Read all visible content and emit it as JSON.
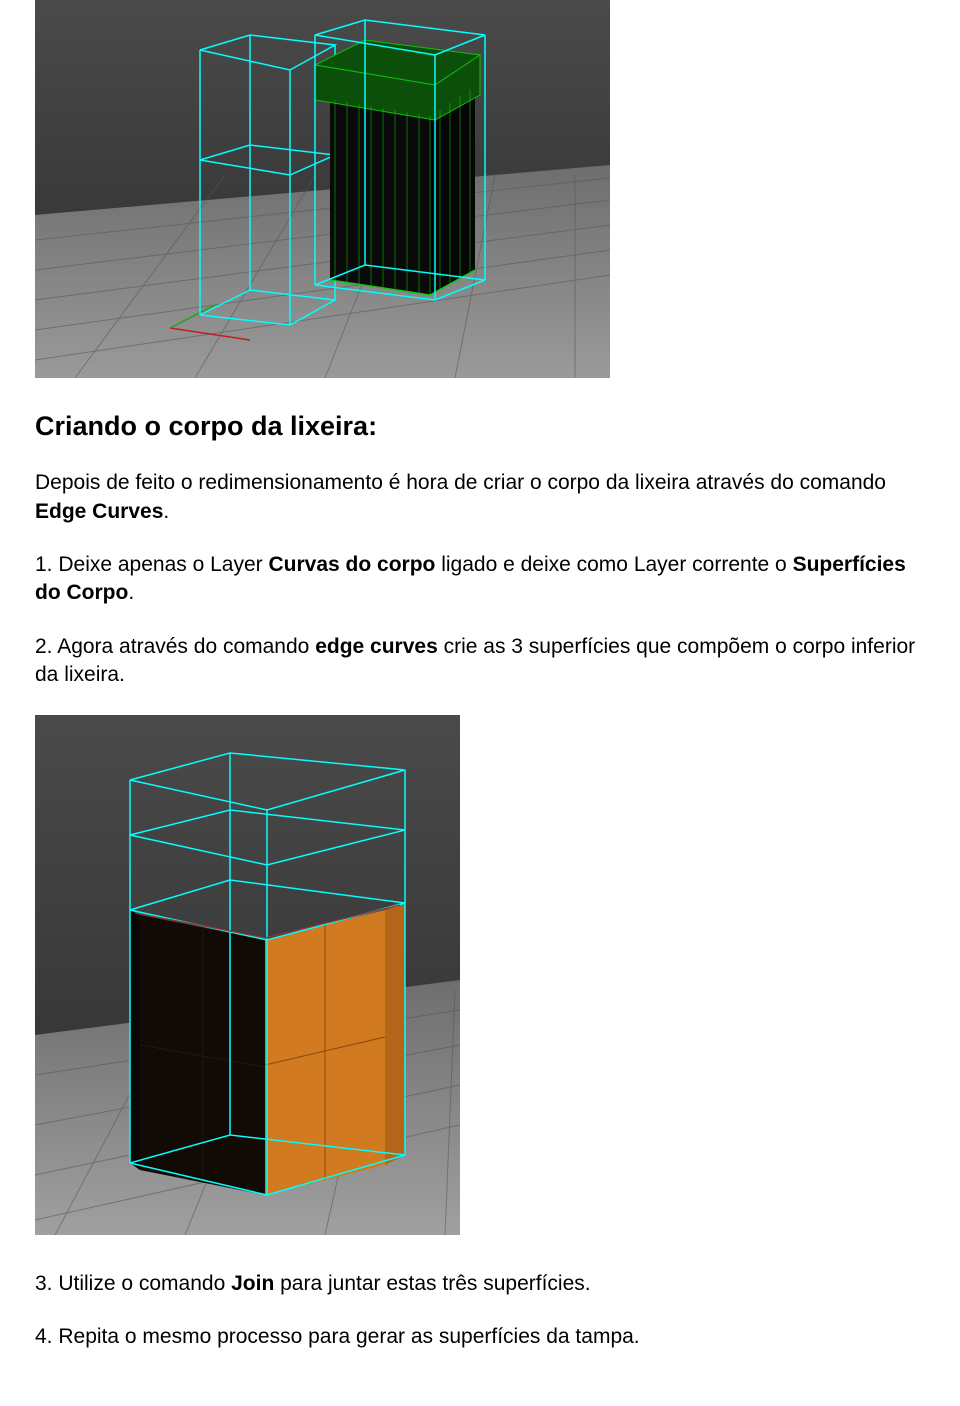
{
  "heading": "Criando o corpo da lixeira:",
  "intro": {
    "t1": "Depois de feito o redimensionamento é hora de criar o corpo da lixeira através do comando ",
    "b1": "Edge Curves",
    "t2": "."
  },
  "step1": {
    "t1": "1. Deixe apenas o Layer ",
    "b1": "Curvas do corpo",
    "t2": " ligado e deixe como Layer corrente o ",
    "b2": "Superfícies do Corpo",
    "t3": "."
  },
  "step2": {
    "t1": "2. Agora através do comando ",
    "b1": "edge curves",
    "t2": " crie as 3 superfícies que compõem o corpo inferior da lixeira."
  },
  "step3": {
    "t1": "3. Utilize o comando ",
    "b1": "Join",
    "t2": " para juntar estas três superfícies."
  },
  "step4": {
    "t1": "4. Repita o mesmo processo para gerar as superfícies da tampa."
  }
}
